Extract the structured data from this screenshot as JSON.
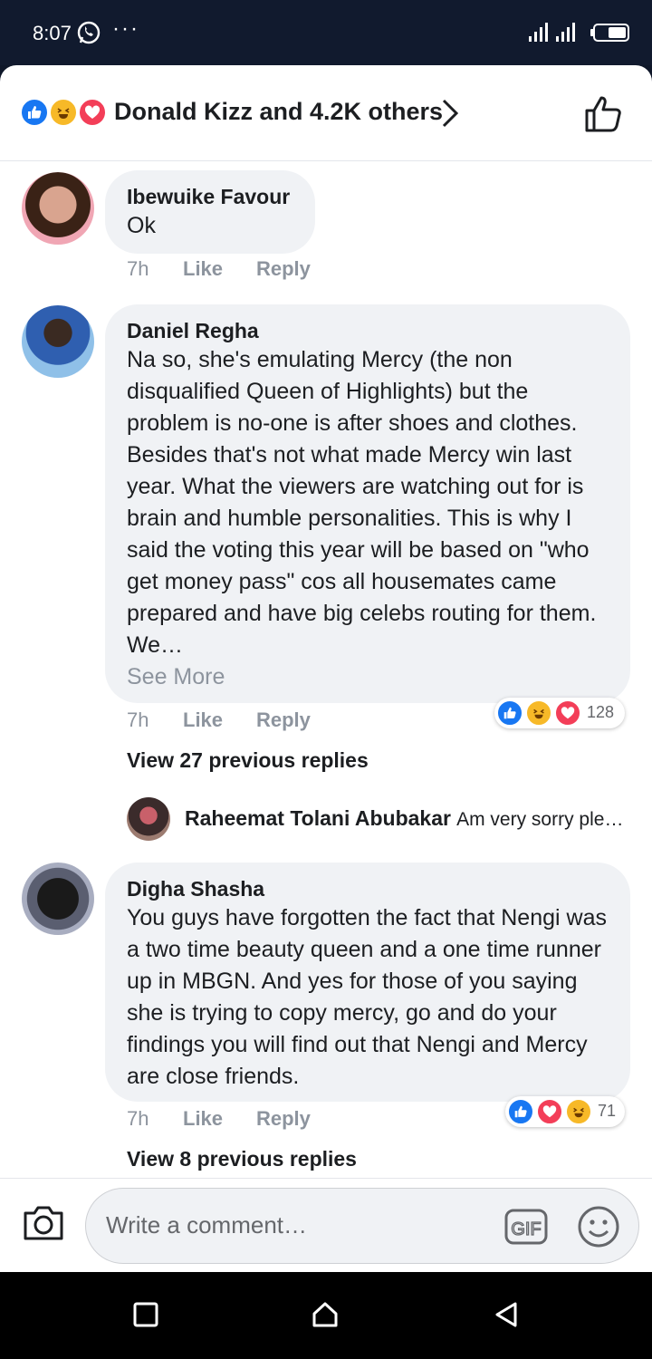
{
  "status_bar": {
    "time": "8:07",
    "dots": "···"
  },
  "header": {
    "reactions": [
      "like",
      "haha",
      "love"
    ],
    "summary": "Donald Kizz and 4.2K others",
    "chevron_icon": "chevron-right-icon",
    "like_icon": "thumbs-up-outline-icon"
  },
  "comments": [
    {
      "author": "Ibewuike Favour",
      "text": "Ok",
      "time": "7h",
      "like": "Like",
      "reply": "Reply"
    },
    {
      "author": "Daniel Regha",
      "text": "Na so, she's emulating Mercy (the non disqualified Queen of Highlights) but the problem is no-one is after shoes and clothes. Besides that's not what made Mercy win last year. What the viewers are watching out for is brain and humble personalities. This is why I said the voting this year will be based on \"who get money pass\" cos all housemates came prepared and have big celebs routing for them. We…",
      "see_more": "See More",
      "time": "7h",
      "like": "Like",
      "reply": "Reply",
      "reactions": [
        "like",
        "haha",
        "love"
      ],
      "reaction_count": "128",
      "view_replies": "View 27 previous replies",
      "reply_preview": {
        "author": "Raheemat Tolani Abubakar",
        "text": "Am very sorry ple…"
      }
    },
    {
      "author": "Digha Shasha",
      "text": "You guys have forgotten the fact that Nengi was a two time beauty queen and a one time runner up in MBGN. And yes for those of you saying she is trying to copy mercy, go and do your findings you will find out that Nengi and Mercy are close friends.",
      "time": "7h",
      "like": "Like",
      "reply": "Reply",
      "reactions": [
        "like",
        "love",
        "haha"
      ],
      "reaction_count": "71",
      "view_replies": "View 8 previous replies"
    }
  ],
  "composer": {
    "placeholder": "Write a comment…",
    "camera_icon": "camera-icon",
    "gif_icon": "gif-icon",
    "emoji_icon": "smiley-icon"
  },
  "colors": {
    "like": "#1877f2",
    "haha": "#f7b928",
    "love": "#f33e58",
    "bubble": "#f0f2f5",
    "meta": "#8d949e"
  }
}
